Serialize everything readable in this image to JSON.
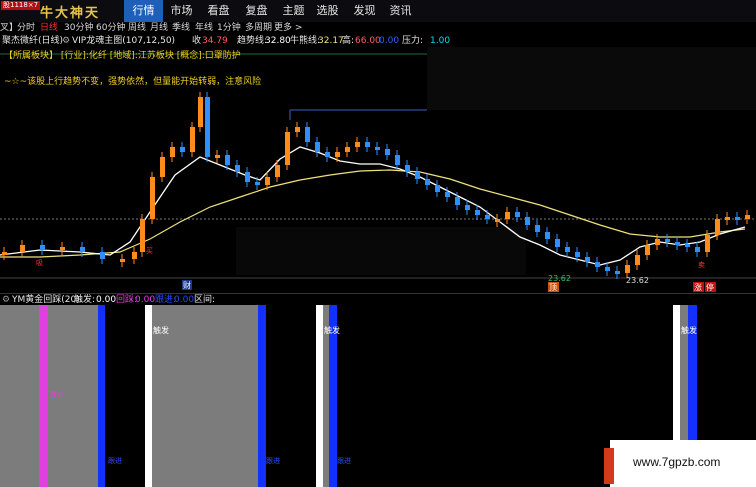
{
  "topbar": {
    "logo_tag": "股1118×7",
    "logo_text": "牛大神天",
    "tabs": [
      "行情",
      "市场",
      "看盘",
      "复盘",
      "主题",
      "选股",
      "发现",
      "资讯"
    ],
    "active_tab": "行情"
  },
  "periodbar": {
    "items": [
      "叉】",
      "分时",
      "日线",
      "30分钟",
      "60分钟",
      "周线",
      "月线",
      "季线",
      "年线",
      "1分钟",
      "多周期",
      "更多 >"
    ],
    "active": "日线"
  },
  "infoline": {
    "stock": "聚杰微纤(日线)",
    "indicator": "VIP龙魂主图(107,12,50)",
    "indicator_icon": "gear-icon",
    "close_label": "收",
    "close_value": "34.79",
    "trend_label": "趋势线:",
    "trend_value": "32.80",
    "bull_label": "牛熊线:",
    "bull_value": "32.17",
    "high_label": "高:",
    "high_value": "66.00",
    "extra": "0.00",
    "pressure_label": "压力:",
    "pressure_value": "1.00"
  },
  "chart": {
    "tags_line": "【所属板块】 [行业]:化纤 [地域]:江苏板块 [概念]:口罩防护",
    "comment": "~☆~该股上行趋势不变，强势依然，但量能开始转弱，注意风险",
    "price_labels": [
      "23.62",
      "23.62"
    ],
    "bottom_markers": [
      "财",
      "顶",
      "涨",
      "停"
    ],
    "signal_labels": [
      "买",
      "吸",
      "卖"
    ]
  },
  "lower": {
    "title": "YM黄金回踩(20)",
    "trigger_label": "触发:",
    "trigger_value": "0.00",
    "pullback_label": "回踩:",
    "pullback_value": "0.00",
    "buy_label": "跟进:",
    "buy_value": "0.00",
    "zone_label": "区间:",
    "bar_labels": [
      "触发",
      "触发",
      "触发"
    ],
    "small_labels": [
      "建仓",
      "跟进",
      "跟进",
      "跟进"
    ]
  },
  "watermark": {
    "text": "www.7gpzb.com"
  },
  "colors": {
    "up": "#ff8c1a",
    "down": "#2f8fff",
    "active_tab": "#1e5fb8",
    "ma_white": "#ffffff",
    "ma_yellow": "#f0e27a",
    "magenta": "#e040e0",
    "blue_bar": "#1430ff"
  }
}
